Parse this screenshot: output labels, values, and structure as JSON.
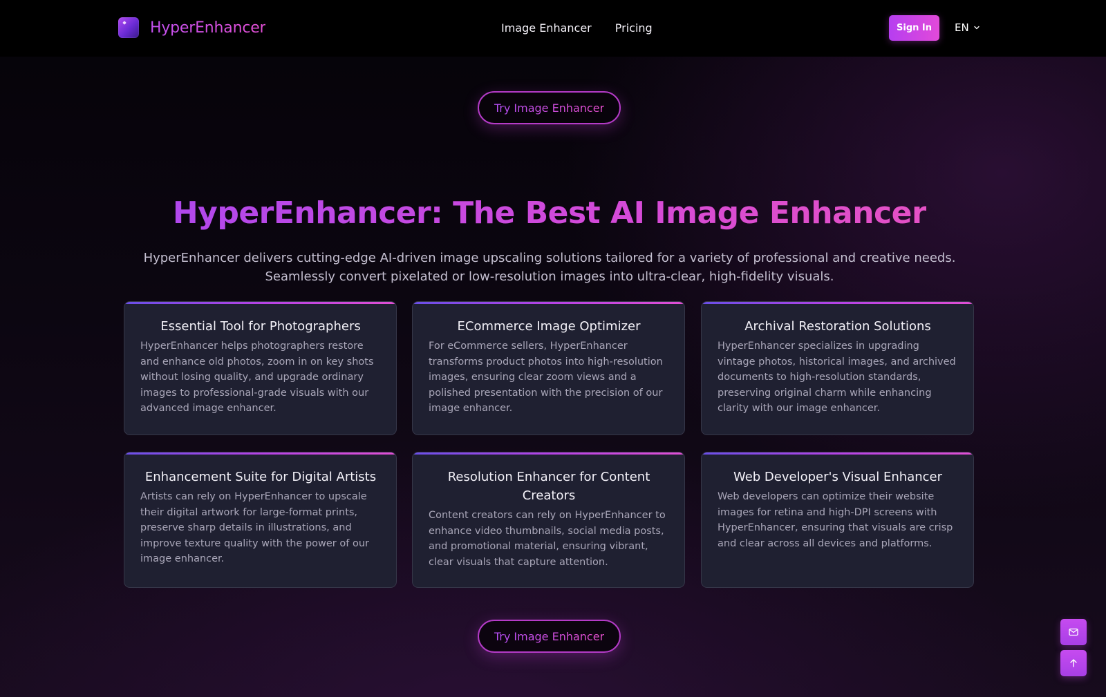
{
  "brand": {
    "name": "HyperEnhancer"
  },
  "nav": {
    "items": [
      "Image Enhancer",
      "Pricing"
    ]
  },
  "header": {
    "signin_label": "Sign In",
    "language": "EN"
  },
  "cta": {
    "label": "Try Image Enhancer"
  },
  "hero": {
    "title": "HyperEnhancer: The Best AI Image Enhancer",
    "subtitle": "HyperEnhancer delivers cutting-edge AI-driven image upscaling solutions tailored for a variety of professional and creative needs. Seamlessly convert pixelated or low-resolution images into ultra-clear, high-fidelity visuals."
  },
  "cards": [
    {
      "title": "Essential Tool for Photographers",
      "body": "HyperEnhancer helps photographers restore and enhance old photos, zoom in on key shots without losing quality, and upgrade ordinary images to professional-grade visuals with our advanced image enhancer."
    },
    {
      "title": "ECommerce Image Optimizer",
      "body": "For eCommerce sellers, HyperEnhancer transforms product photos into high-resolution images, ensuring clear zoom views and a polished presentation with the precision of our image enhancer."
    },
    {
      "title": "Archival Restoration Solutions",
      "body": "HyperEnhancer specializes in upgrading vintage photos, historical images, and archived documents to high-resolution standards, preserving original charm while enhancing clarity with our image enhancer."
    },
    {
      "title": "Enhancement Suite for Digital Artists",
      "body": "Artists can rely on HyperEnhancer to upscale their digital artwork for large-format prints, preserve sharp details in illustrations, and improve texture quality with the power of our image enhancer."
    },
    {
      "title": "Resolution Enhancer for Content Creators",
      "body": "Content creators can rely on HyperEnhancer to enhance video thumbnails, social media posts, and promotional material, ensuring vibrant, clear visuals that capture attention."
    },
    {
      "title": "Web Developer's Visual Enhancer",
      "body": "Web developers can optimize their website images for retina and high-DPI screens with HyperEnhancer, ensuring that visuals are crisp and clear across all devices and platforms."
    }
  ],
  "icons": {
    "logo": "logo-icon",
    "chevron": "chevron-down-icon",
    "mail": "mail-icon",
    "up": "arrow-up-icon"
  },
  "colors": {
    "accent": "#c34af0",
    "card_bg": "#1f2031",
    "page_bg": "#000000"
  }
}
